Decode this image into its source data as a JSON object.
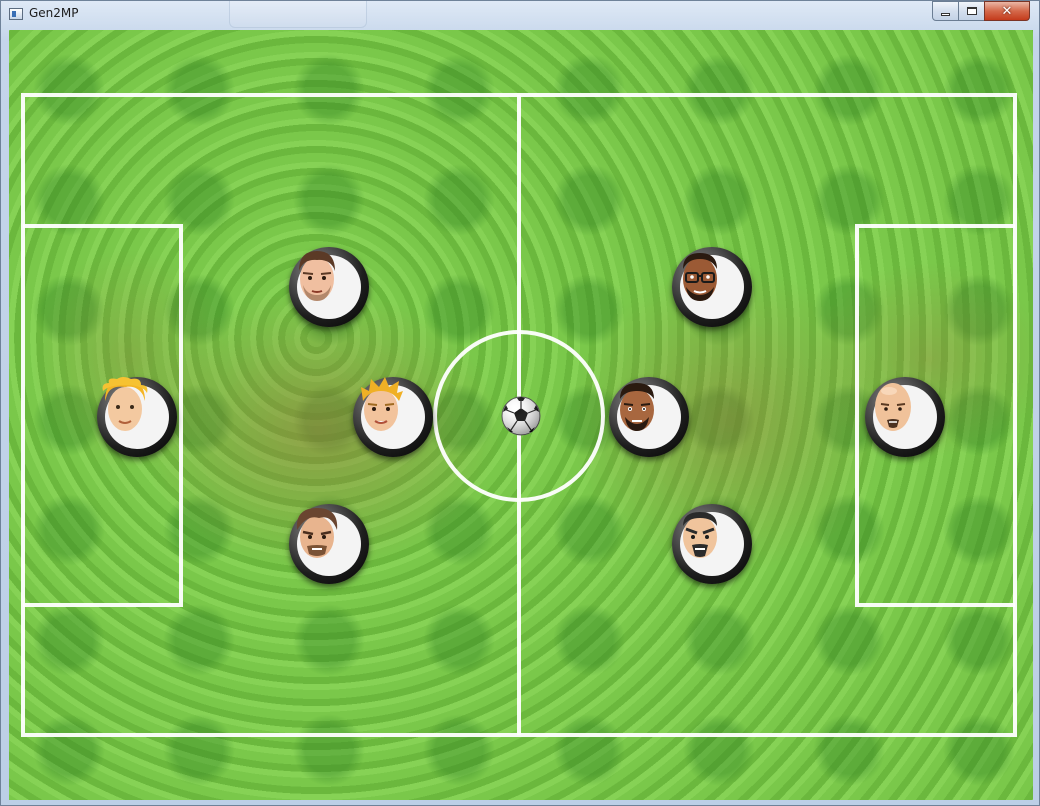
{
  "window": {
    "title": "Gen2MP",
    "buttons": {
      "minimize": "minimize",
      "maximize": "maximize",
      "close": "✕"
    }
  },
  "game": {
    "field_color": "#78c448",
    "line_color": "#ffffff",
    "players_left": [
      {
        "name": "keeper-left",
        "skin": "#f3c9a0",
        "hair": "#f4b526",
        "beard": ""
      },
      {
        "name": "left-top",
        "skin": "#f0bfa0",
        "hair": "#5b3a26",
        "beard": "#6b4a34"
      },
      {
        "name": "left-mid",
        "skin": "#f2c39c",
        "hair": "#f0b025",
        "beard": ""
      },
      {
        "name": "left-bottom",
        "skin": "#e8b48e",
        "hair": "#6a4530",
        "beard": "#7a5235"
      }
    ],
    "players_right": [
      {
        "name": "right-top",
        "skin": "#9b5a35",
        "hair": "#2a1a10",
        "beard": "#2a1a10",
        "glasses": true
      },
      {
        "name": "right-mid",
        "skin": "#a8673f",
        "hair": "#2a1a10",
        "beard": "#2a1a10"
      },
      {
        "name": "right-bottom",
        "skin": "#f0c49c",
        "hair": "#2b2b2b",
        "beard": "#2b2b2b"
      },
      {
        "name": "keeper-right",
        "skin": "#f0c29a",
        "hair": "",
        "beard": "#4a3020"
      }
    ]
  }
}
